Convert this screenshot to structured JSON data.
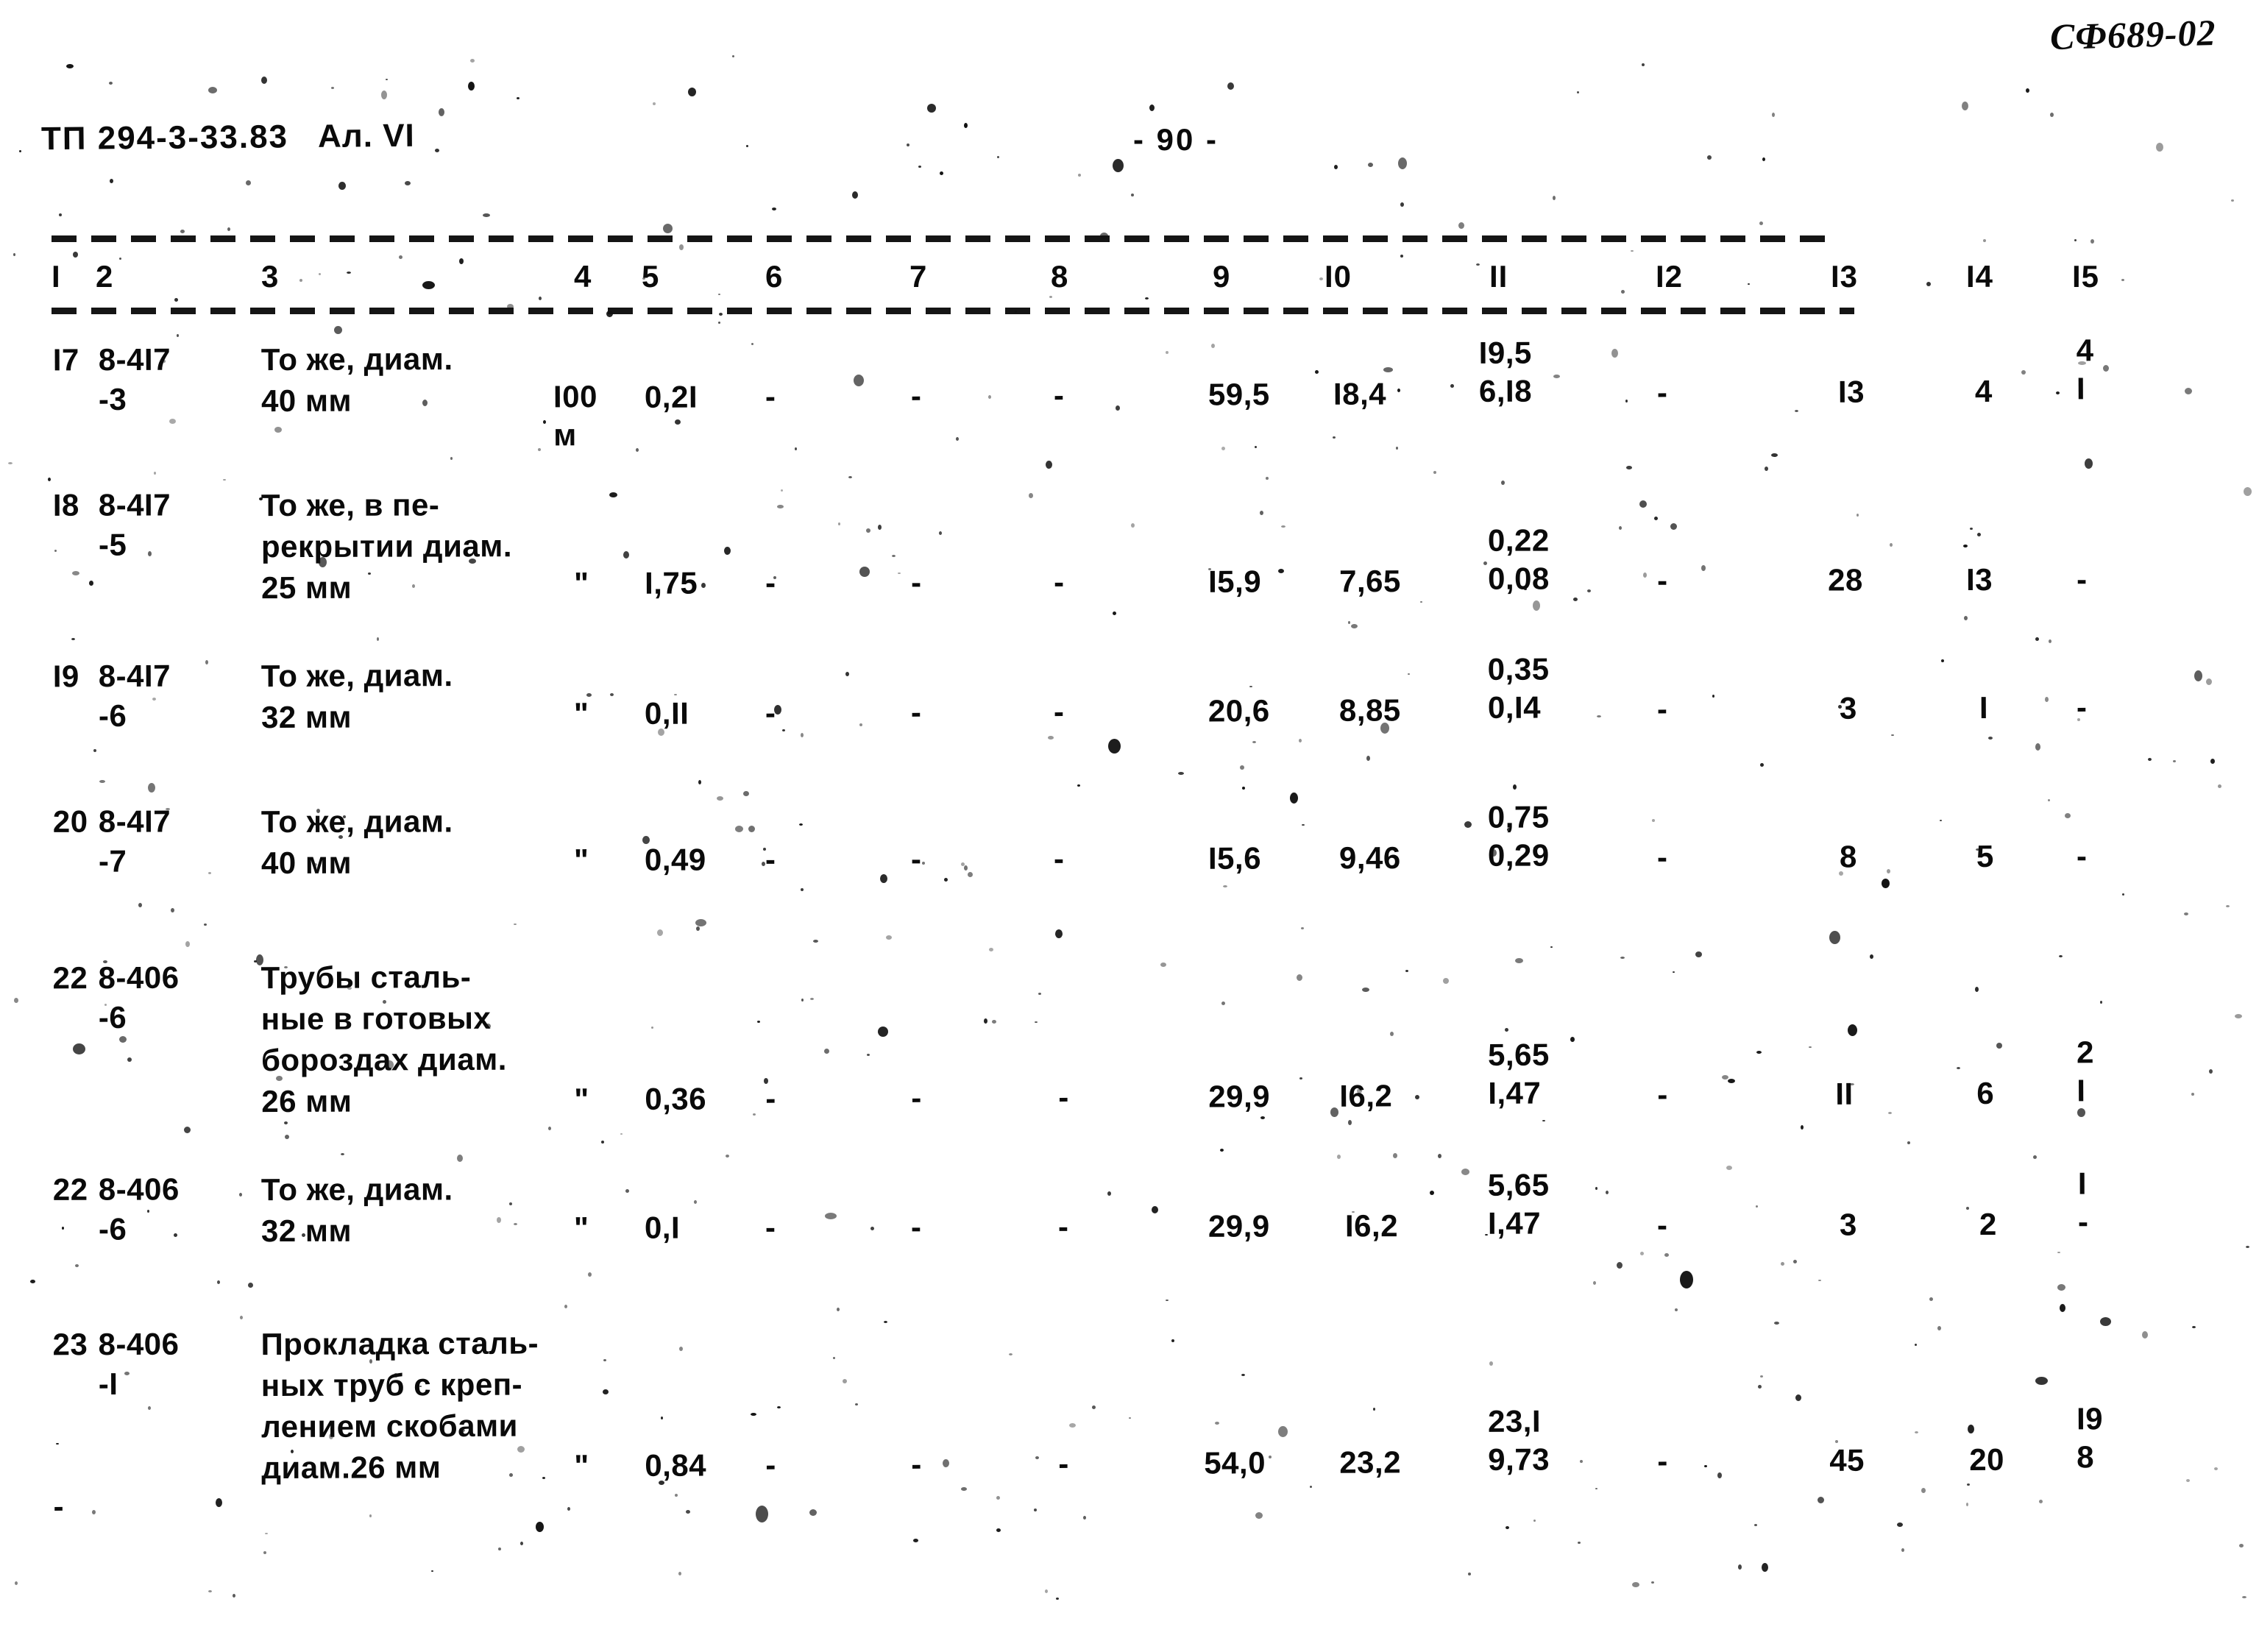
{
  "header": {
    "hand_code": "СФ689-02",
    "doc_code": "ТП  294-3-33.83",
    "album": "Ал. VI",
    "page_number": "- 90 -"
  },
  "table": {
    "column_headers": [
      "I",
      "2",
      "3",
      "4",
      "5",
      "6",
      "7",
      "8",
      "9",
      "I0",
      "II",
      "I2",
      "I3",
      "I4",
      "I5"
    ],
    "rows": [
      {
        "c1": "I7",
        "c2": "8-4I7\n-3",
        "c3": "То же, диам.\n40 мм",
        "c4": "I00\nм",
        "c5": "0,2I",
        "c6": "-",
        "c7": "-",
        "c8": "-",
        "c9": "59,5",
        "c10": "I8,4",
        "c11": "I9,5\n6,I8",
        "c12": "-",
        "c13": "I3",
        "c14": "4",
        "c15": "4\nI"
      },
      {
        "c1": "I8",
        "c2": "8-4I7\n-5",
        "c3": "То же, в пе-\nрекрытии диам.\n25 мм",
        "c4": "\"",
        "c5": "I,75",
        "c6": "-",
        "c7": "-",
        "c8": "-",
        "c9": "I5,9",
        "c10": "7,65",
        "c11": "0,22\n0,08",
        "c12": "-",
        "c13": "28",
        "c14": "I3",
        "c15": "-"
      },
      {
        "c1": "I9",
        "c2": "8-4I7\n-6",
        "c3": "То же, диам.\n32 мм",
        "c4": "\"",
        "c5": "0,II",
        "c6": "-",
        "c7": "-",
        "c8": "-",
        "c9": "20,6",
        "c10": "8,85",
        "c11": "0,35\n0,I4",
        "c12": "-",
        "c13": "3",
        "c14": "I",
        "c15": "-"
      },
      {
        "c1": "20",
        "c2": "8-4I7\n-7",
        "c3": "То же, диам.\n40 мм",
        "c4": "\"",
        "c5": "0,49",
        "c6": "-",
        "c7": "-",
        "c8": "-",
        "c9": "I5,6",
        "c10": "9,46",
        "c11": "0,75\n0,29",
        "c12": "-",
        "c13": "8",
        "c14": "5",
        "c15": "-"
      },
      {
        "c1": "22",
        "c2": "8-406\n-6",
        "c3": "Трубы сталь-\nные в готовых\nбороздах диам.\n26 мм",
        "c4": "\"",
        "c5": "0,36",
        "c6": "-",
        "c7": "-",
        "c8": "-",
        "c9": "29,9",
        "c10": "I6,2",
        "c11": "5,65\nI,47",
        "c12": "-",
        "c13": "II",
        "c14": "6",
        "c15": "2\nI"
      },
      {
        "c1": "22",
        "c2": "8-406\n-6",
        "c3": "То же, диам.\n32 мм",
        "c4": "\"",
        "c5": "0,I",
        "c6": "-",
        "c7": "-",
        "c8": "-",
        "c9": "29,9",
        "c10": "I6,2",
        "c11": "5,65\nI,47",
        "c12": "-",
        "c13": "3",
        "c14": "2",
        "c15": "I\n-"
      },
      {
        "c1": "23",
        "c2": "8-406\n-I",
        "c3": "Прокладка сталь-\nных труб с креп-\nлением скобами\nдиам.26 мм",
        "c4": "\"",
        "c5": "0,84",
        "c6": "-",
        "c7": "-",
        "c8": "-",
        "c9": "54,0",
        "c10": "23,2",
        "c11": "23,I\n9,73",
        "c12": "-",
        "c13": "45",
        "c14": "20",
        "c15": "I9\n8"
      }
    ],
    "trailing_mark": "-"
  }
}
